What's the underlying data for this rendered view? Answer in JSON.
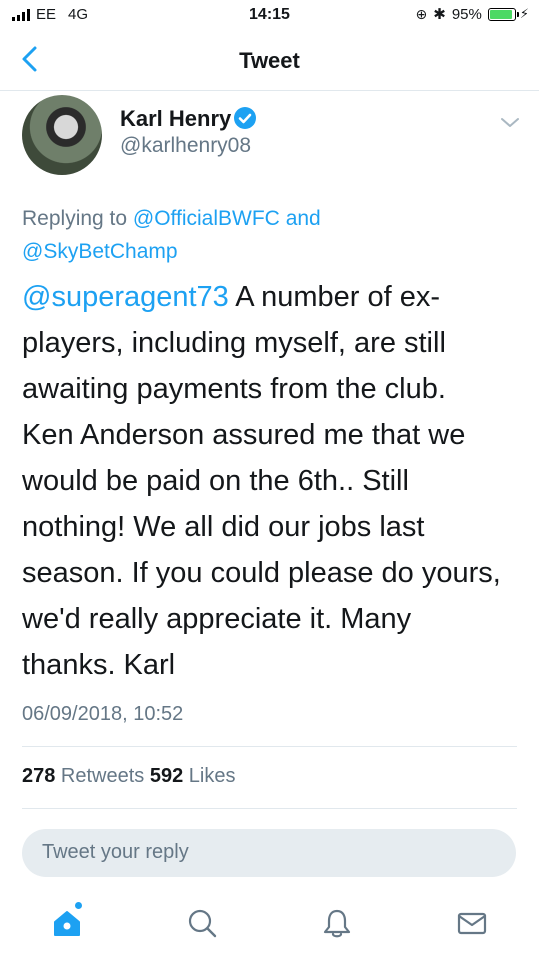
{
  "status_bar": {
    "carrier": "EE",
    "network": "4G",
    "time": "14:15",
    "battery_percent": "95%",
    "battery_level": 0.95
  },
  "header": {
    "title": "Tweet"
  },
  "tweet": {
    "author_name": "Karl Henry",
    "author_handle": "@karlhenry08",
    "replying_to_prefix": "Replying to ",
    "replying_to_1": "@OfficialBWFC",
    "replying_to_and": " and",
    "replying_to_2": "@SkyBetChamp",
    "mention": "@superagent73",
    "text_lines": [
      " A number of ex-",
      "players, including myself, are still",
      "awaiting payments from the club.",
      "Ken Anderson assured me that we",
      "would be paid on the 6th.. Still",
      "nothing! We all did our jobs last",
      "season. If you could please do yours,",
      "we'd really appreciate it. Many",
      "thanks. Karl"
    ],
    "timestamp": "06/09/2018, 10:52",
    "retweets_count": "278",
    "retweets_label": " Retweets ",
    "likes_count": "592",
    "likes_label": " Likes"
  },
  "reply": {
    "placeholder": "Tweet your reply"
  },
  "tabbar": {
    "items": [
      "home-icon",
      "search-icon",
      "notifications-icon",
      "messages-icon"
    ],
    "accent_color": "#1da1f2",
    "inactive_color": "#657786"
  }
}
